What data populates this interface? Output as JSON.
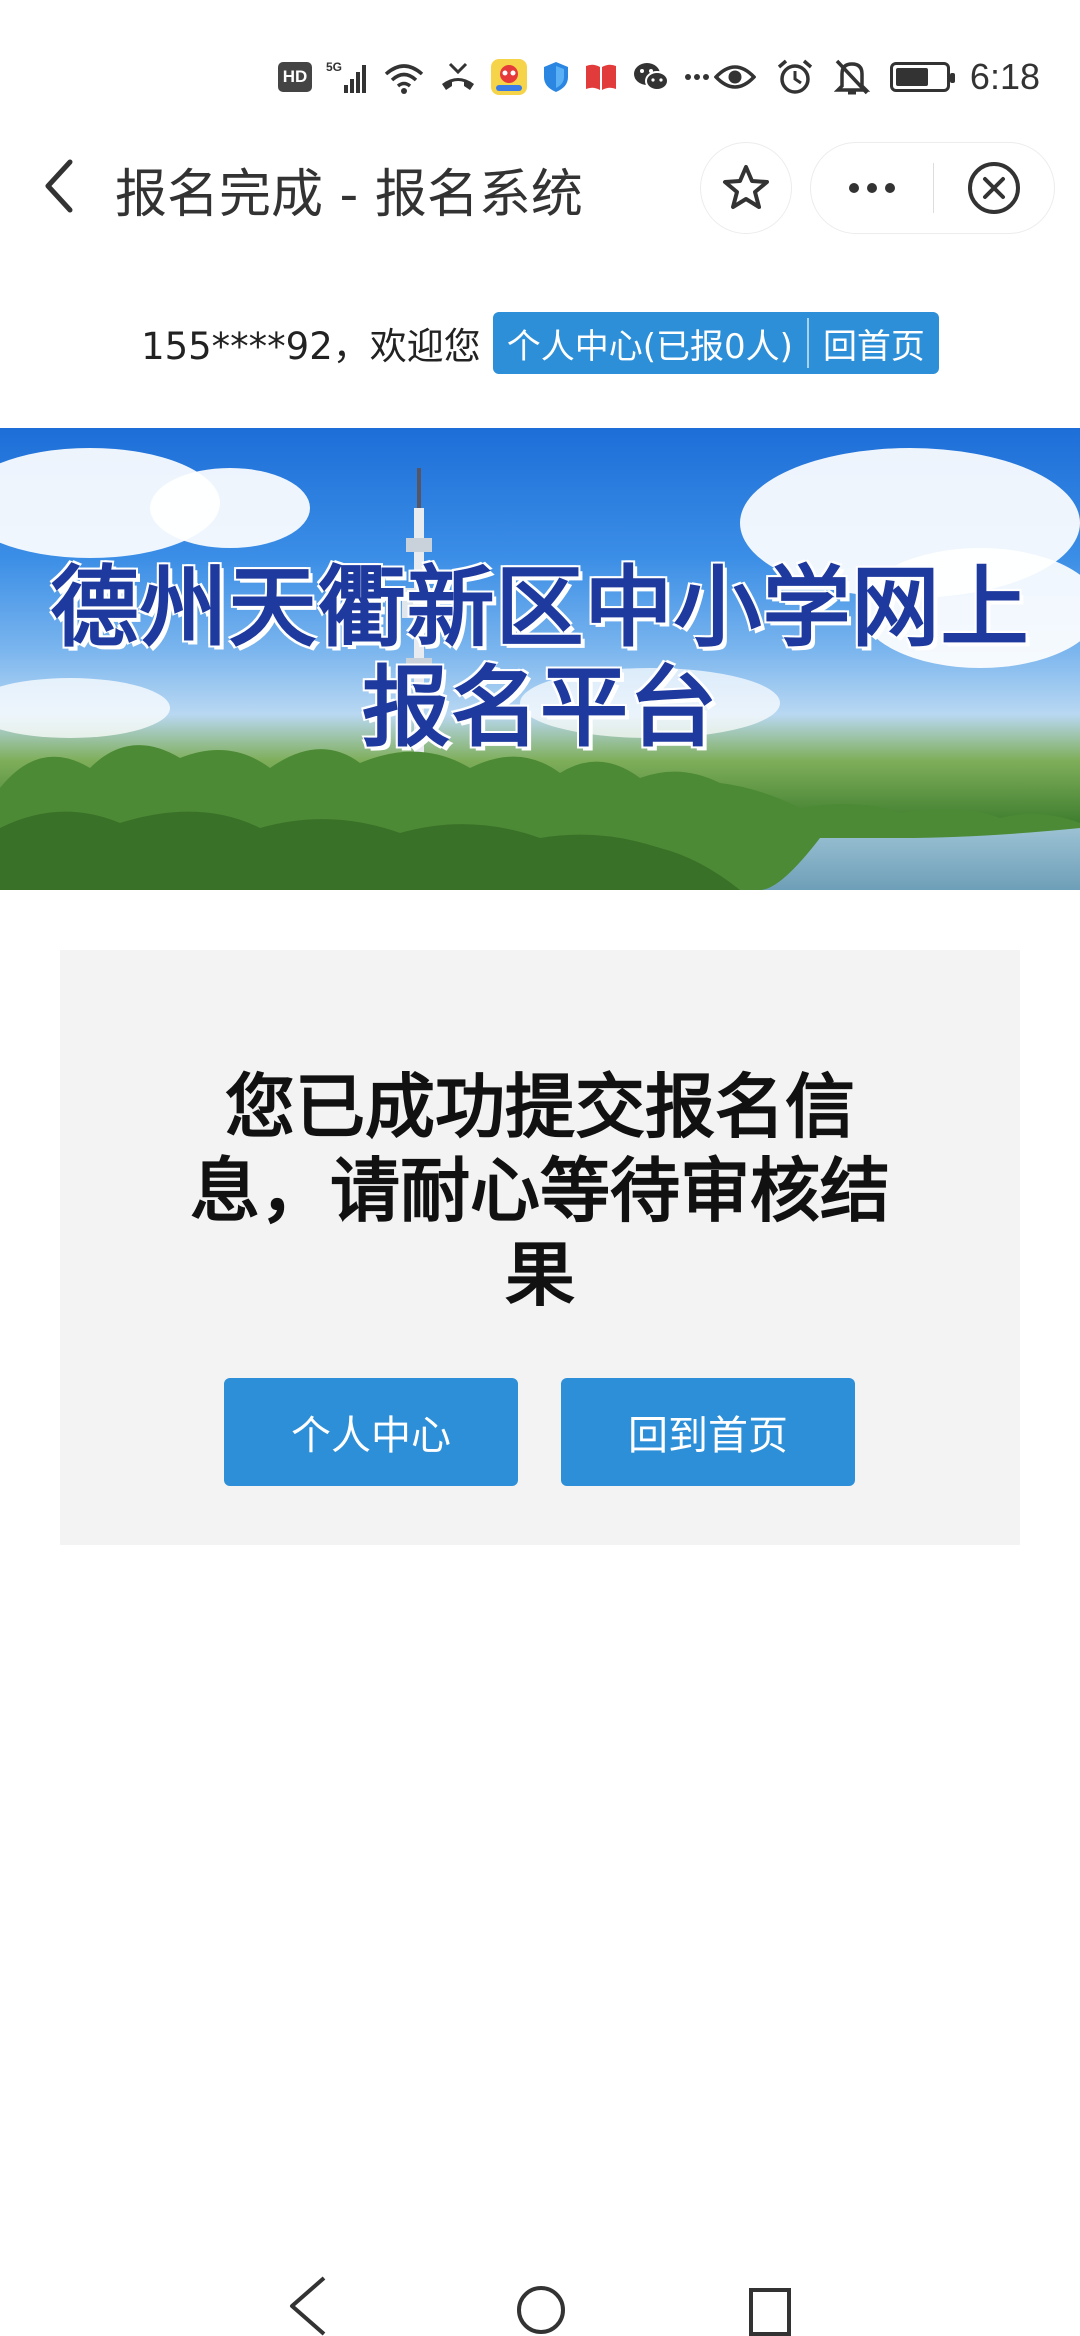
{
  "status_bar": {
    "hd_label": "HD",
    "network_label": "5G",
    "time": "6:18",
    "icons": [
      "hd-icon",
      "signal-5g-icon",
      "wifi-icon",
      "missed-call-icon",
      "app-notification-icon",
      "shield-icon",
      "book-icon",
      "wechat-icon",
      "more-notifications-icon",
      "eye-icon",
      "alarm-icon",
      "mute-icon",
      "battery-icon"
    ]
  },
  "nav": {
    "title": "报名完成 - 报名系统",
    "icons": [
      "back-icon",
      "star-icon",
      "more-icon",
      "close-icon"
    ]
  },
  "welcome": {
    "user_text": "155****92，欢迎您",
    "personal_center_label": "个人中心(已报0人)",
    "home_label": "回首页"
  },
  "banner": {
    "title_line1": "德州天衢新区中小学网上",
    "title_line2": "报名平台"
  },
  "result": {
    "message": "您已成功提交报名信息，请耐心等待审核结果",
    "personal_center_button": "个人中心",
    "home_button": "回到首页"
  },
  "colors": {
    "accent_blue": "#2c8fd8",
    "banner_title": "#1f3a9e",
    "card_bg": "#f3f3f3"
  },
  "system_nav": {
    "icons": [
      "back-triangle-icon",
      "home-circle-icon",
      "recents-square-icon"
    ]
  }
}
